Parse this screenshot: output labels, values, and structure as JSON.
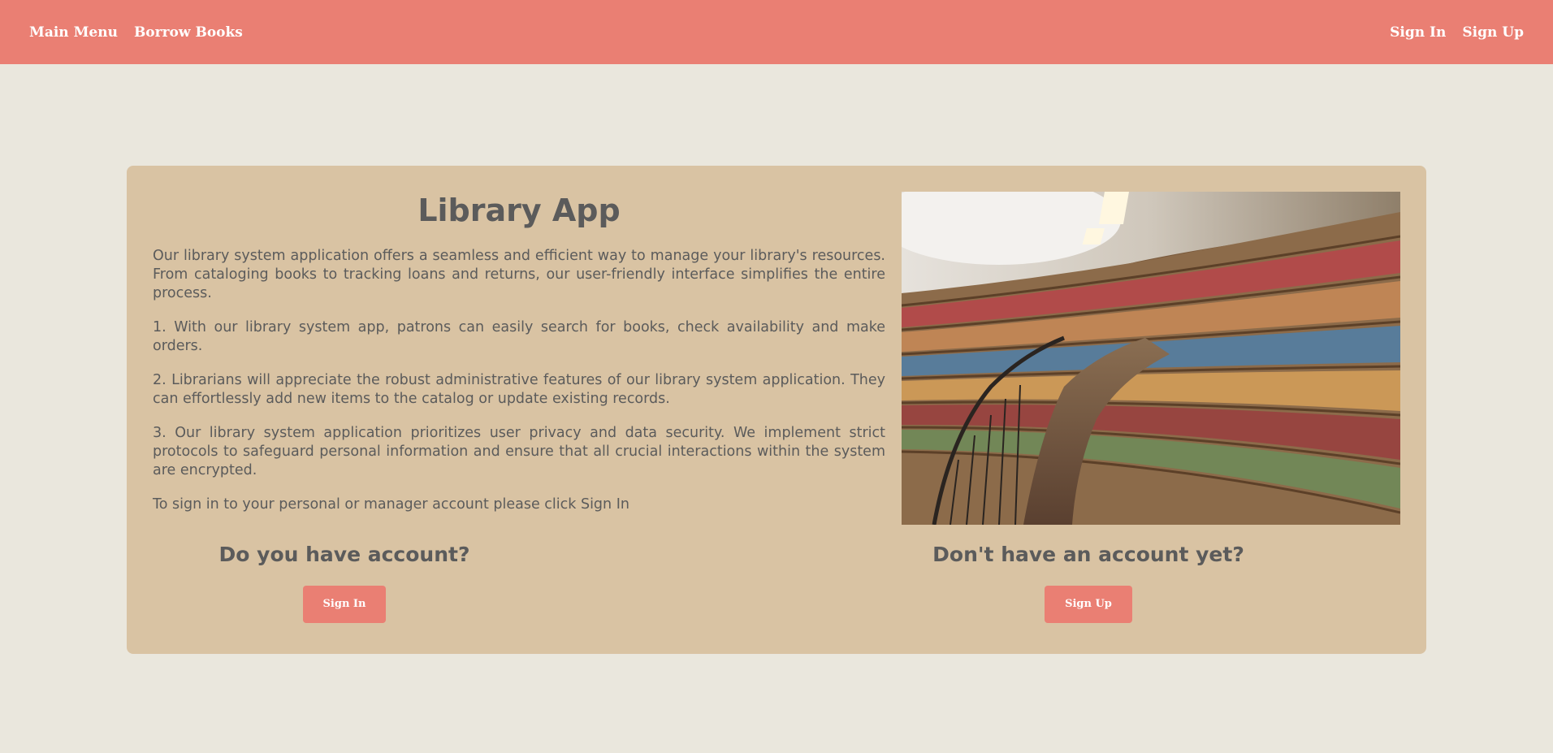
{
  "nav": {
    "left": [
      {
        "label": "Main Menu"
      },
      {
        "label": "Borrow Books"
      }
    ],
    "right": [
      {
        "label": "Sign In"
      },
      {
        "label": "Sign Up"
      }
    ]
  },
  "main": {
    "title": "Library App",
    "intro": "Our library system application offers a seamless and efficient way to manage your library's resources. From cataloging books to tracking loans and returns, our user-friendly interface simplifies the entire process.",
    "points": [
      "1. With our library system app, patrons can easily search for books, check availability and make orders.",
      "2. Librarians will appreciate the robust administrative features of our library system application. They can effortlessly add new items to the catalog or update existing records.",
      "3. Our library system application prioritizes user privacy and data security. We implement strict protocols to safeguard personal information and ensure that all crucial interactions within the system are encrypted."
    ],
    "signin_note": "To sign in to your personal or manager account please click Sign In",
    "image_subject": "curved library bookshelves",
    "signin_cta": {
      "heading": "Do you have account?",
      "button": "Sign In"
    },
    "signup_cta": {
      "heading": "Don't have an account yet?",
      "button": "Sign Up"
    }
  },
  "colors": {
    "navbar": "#ea7f73",
    "background": "#eae7dd",
    "card": "#d9c3a3",
    "text": "#5b5b5b",
    "button": "#ea7f73"
  }
}
